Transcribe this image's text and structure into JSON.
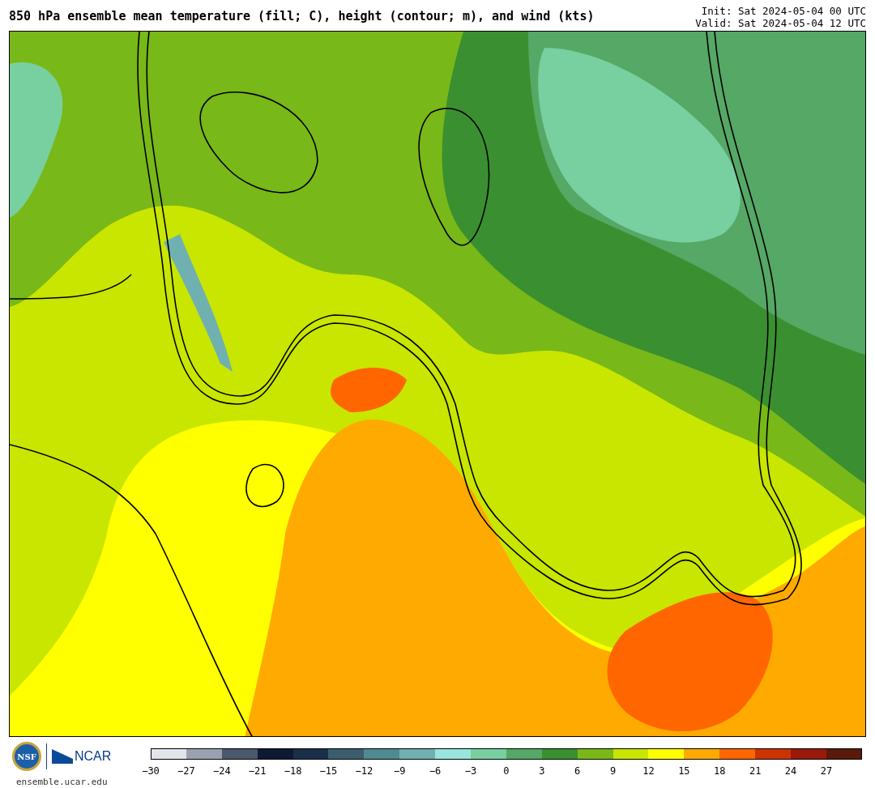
{
  "title": "850 hPa ensemble mean temperature (fill; C), height (contour; m), and wind (kts)",
  "init": "Init: Sat 2024-05-04 00 UTC",
  "valid": "Valid: Sat 2024-05-04 12 UTC",
  "logos": {
    "nsf": "NSF",
    "ncar": "NCAR",
    "site": "ensemble.ucar.edu"
  },
  "colorbar": {
    "bins": [
      {
        "label": "−30",
        "color": "#e2e5ea"
      },
      {
        "label": "−27",
        "color": "#9aa2b2"
      },
      {
        "label": "−24",
        "color": "#4a596b"
      },
      {
        "label": "−21",
        "color": "#0e1a34"
      },
      {
        "label": "−18",
        "color": "#1c2f4a"
      },
      {
        "label": "−15",
        "color": "#3a5e6e"
      },
      {
        "label": "−12",
        "color": "#4f8a90"
      },
      {
        "label": "−9",
        "color": "#70b0b0"
      },
      {
        "label": "−6",
        "color": "#98e6de"
      },
      {
        "label": "−3",
        "color": "#78d0a0"
      },
      {
        "label": "0",
        "color": "#55a865"
      },
      {
        "label": "3",
        "color": "#3a9030"
      },
      {
        "label": "6",
        "color": "#78b818"
      },
      {
        "label": "9",
        "color": "#c8e600"
      },
      {
        "label": "12",
        "color": "#ffff00"
      },
      {
        "label": "15",
        "color": "#ffaa00"
      },
      {
        "label": "18",
        "color": "#ff6600"
      },
      {
        "label": "21",
        "color": "#cc3300"
      },
      {
        "label": "24",
        "color": "#991a0a"
      },
      {
        "label": "27",
        "color": "#5a1a0a"
      }
    ]
  }
}
